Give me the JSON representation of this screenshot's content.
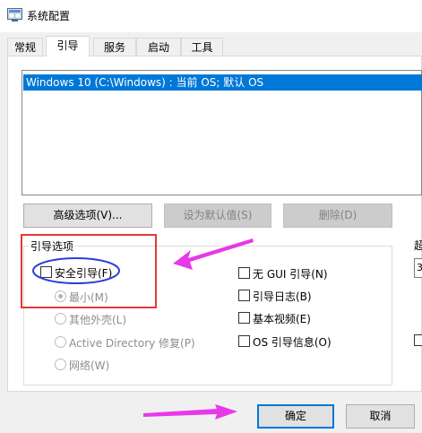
{
  "window": {
    "title": "系统配置"
  },
  "tabs": [
    "常规",
    "引导",
    "服务",
    "启动",
    "工具"
  ],
  "active_tab": "引导",
  "boot_list": {
    "items": [
      "Windows 10 (C:\\Windows) : 当前 OS; 默认 OS"
    ]
  },
  "buttons": {
    "advanced": "高级选项(V)...",
    "set_default": "设为默认值(S)",
    "delete": "删除(D)",
    "ok": "确定",
    "cancel": "取消"
  },
  "boot_options": {
    "title": "引导选项",
    "safe_boot": "安全引导(F)",
    "radios": [
      "最小(M)",
      "其他外壳(L)",
      "Active Directory 修复(P)",
      "网络(W)"
    ],
    "checkboxes": [
      "无 GUI 引导(N)",
      "引导日志(B)",
      "基本视频(E)",
      "OS 引导信息(O)"
    ]
  },
  "right_fragment": {
    "label": "超",
    "value": "3"
  },
  "colors": {
    "selection": "#0078d7",
    "annotation_red": "#e53935",
    "annotation_blue": "#2c3fd6",
    "arrow_magenta": "#e838e8"
  }
}
